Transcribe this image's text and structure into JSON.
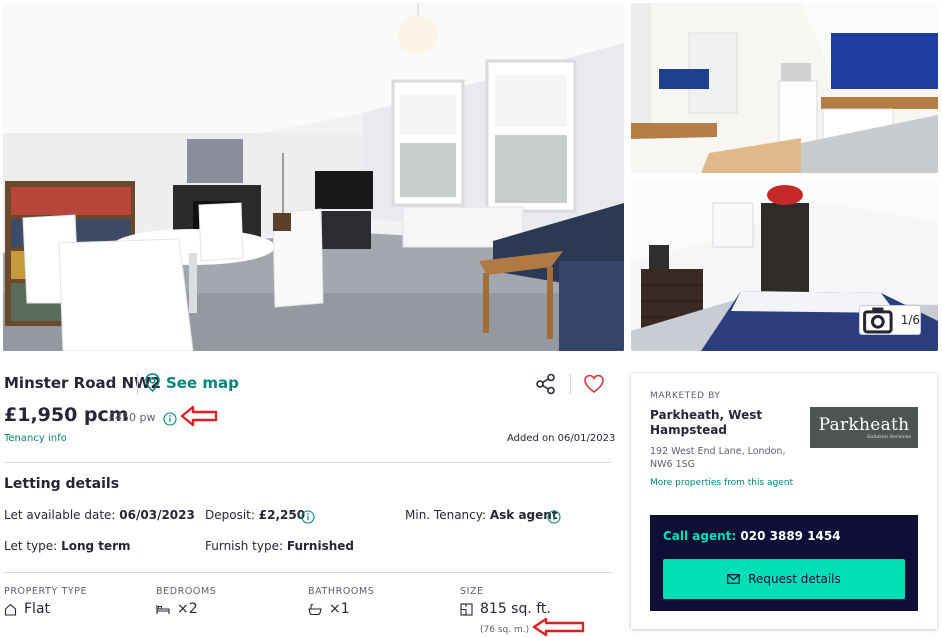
{
  "gallery": {
    "counter": "1/6",
    "counter_icon": "camera-icon"
  },
  "property": {
    "address": "Minster Road NW2",
    "see_map": "See map",
    "price": "£1,950 pcm",
    "price_weekly": "£450 pw",
    "tenancy_info": "Tenancy info",
    "added_on": "Added on 06/01/2023"
  },
  "letting": {
    "title": "Letting details",
    "available_label": "Let available date:",
    "available_value": "06/03/2023",
    "deposit_label": "Deposit:",
    "deposit_value": "£2,250",
    "min_tenancy_label": "Min. Tenancy:",
    "min_tenancy_value": "Ask agent",
    "let_type_label": "Let type:",
    "let_type_value": "Long term",
    "furnish_label": "Furnish type:",
    "furnish_value": "Furnished"
  },
  "stats": [
    {
      "label": "PROPERTY TYPE",
      "value": "Flat",
      "icon": "house-icon"
    },
    {
      "label": "BEDROOMS",
      "value": "×2",
      "icon": "bed-icon"
    },
    {
      "label": "BATHROOMS",
      "value": "×1",
      "icon": "bath-icon"
    },
    {
      "label": "SIZE",
      "value": "815 sq. ft.",
      "icon": "floorplan-icon",
      "secondary": "(76 sq. m.)"
    }
  ],
  "agent": {
    "marketed_by": "MARKETED BY",
    "name": "Parkheath, West Hampstead",
    "address": "192 West End Lane, London, NW6 1SG",
    "more_properties": "More properties from this agent",
    "logo_text": "Parkheath",
    "logo_subtext": "Solution Services",
    "call_label": "Call agent:",
    "phone": "020 3889 1454",
    "request_button": "Request details"
  },
  "colors": {
    "accent_teal": "#00857a",
    "cta_mint": "#00deb6",
    "navy": "#0e0e36",
    "annotation_red": "#e02020"
  }
}
